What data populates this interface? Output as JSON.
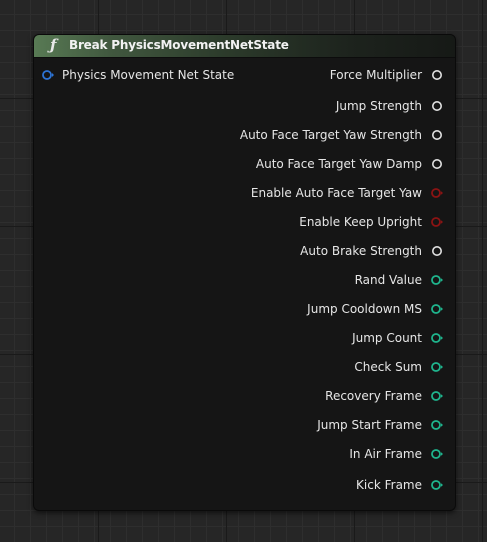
{
  "node": {
    "title": "Break PhysicsMovementNetState",
    "icon": "function-icon",
    "header_color": "#587a54"
  },
  "input": {
    "label": "Physics Movement Net State",
    "color": "#2d74d6"
  },
  "outputs": [
    {
      "label": "Force Multiplier",
      "color": "#e0e0e0",
      "type": "float"
    },
    {
      "label": "Jump Strength",
      "color": "#e0e0e0",
      "type": "float"
    },
    {
      "label": "Auto Face Target Yaw Strength",
      "color": "#e0e0e0",
      "type": "float"
    },
    {
      "label": "Auto Face Target Yaw Damp",
      "color": "#e0e0e0",
      "type": "float"
    },
    {
      "label": "Enable Auto Face Target Yaw",
      "color": "#8c1313",
      "type": "bool"
    },
    {
      "label": "Enable Keep Upright",
      "color": "#8c1313",
      "type": "bool"
    },
    {
      "label": "Auto Brake Strength",
      "color": "#e0e0e0",
      "type": "float"
    },
    {
      "label": "Rand Value",
      "color": "#1fb58d",
      "type": "int"
    },
    {
      "label": "Jump Cooldown MS",
      "color": "#1fb58d",
      "type": "int"
    },
    {
      "label": "Jump Count",
      "color": "#1fb58d",
      "type": "int"
    },
    {
      "label": "Check Sum",
      "color": "#1fb58d",
      "type": "int"
    },
    {
      "label": "Recovery Frame",
      "color": "#1fb58d",
      "type": "int"
    },
    {
      "label": "Jump Start Frame",
      "color": "#1fb58d",
      "type": "int"
    },
    {
      "label": "In Air Frame",
      "color": "#1fb58d",
      "type": "int"
    },
    {
      "label": "Kick Frame",
      "color": "#1fb58d",
      "type": "int"
    }
  ]
}
